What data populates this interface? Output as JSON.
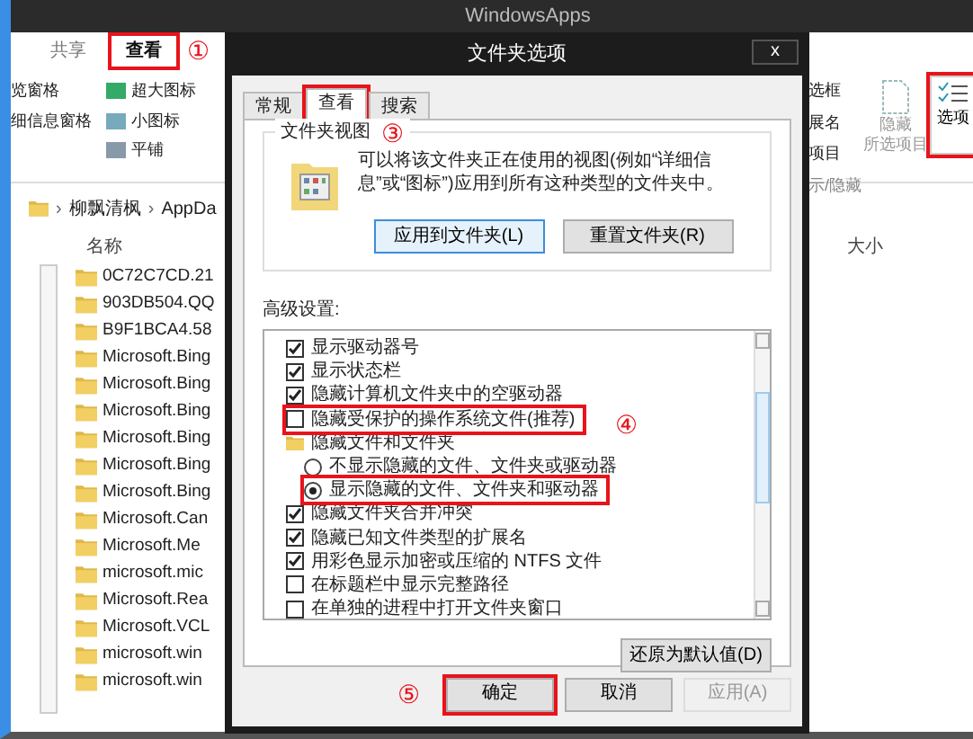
{
  "explorer": {
    "title": "WindowsApps",
    "ribbon_tabs": [
      {
        "label": "共享",
        "selected": false,
        "highlighted": false
      },
      {
        "label": "查看",
        "selected": true,
        "highlighted": true
      }
    ],
    "tab_marker": "①",
    "pane_items": [
      "览窗格",
      "细信息窗格"
    ],
    "layout_items": [
      "超大图标",
      "小图标",
      "平铺"
    ],
    "show_hide_items": [
      "选框",
      "展名",
      "项目"
    ],
    "hide_selected": [
      "隐藏",
      "所选项目"
    ],
    "group_label": "示/隐藏",
    "options_button": {
      "label": "选项",
      "highlighted": true
    },
    "breadcrumb": [
      {
        "separator": "›",
        "label": "柳飘清枫"
      },
      {
        "separator": "›",
        "label": "AppDa"
      }
    ],
    "columns": [
      "名称",
      "大小"
    ],
    "files": [
      "0C72C7CD.21",
      "903DB504.QQ",
      "B9F1BCA4.58",
      "Microsoft.Bing",
      "Microsoft.Bing",
      "Microsoft.Bing",
      "Microsoft.Bing",
      "Microsoft.Bing",
      "Microsoft.Bing",
      "Microsoft.Can",
      "Microsoft.Me",
      "microsoft.mic",
      "Microsoft.Rea",
      "Microsoft.VCL",
      "microsoft.win",
      "microsoft.win"
    ]
  },
  "dialog": {
    "title": "文件夹选项",
    "close": "x",
    "tabs": [
      {
        "label": "常规",
        "selected": false,
        "highlighted": false
      },
      {
        "label": "查看",
        "selected": true,
        "highlighted": true
      },
      {
        "label": "搜索",
        "selected": false,
        "highlighted": false
      }
    ],
    "tab_marker": "③",
    "group_title": "文件夹视图",
    "description": "可以将该文件夹正在使用的视图(例如“详细信息”或“图标”)应用到所有这种类型的文件夹中。",
    "view_buttons": [
      "应用到文件夹(L)",
      "重置文件夹(R)"
    ],
    "advanced_label": "高级设置:",
    "settings": [
      {
        "kind": "checkbox",
        "label": "显示驱动器号",
        "checked": true,
        "highlighted": false
      },
      {
        "kind": "checkbox",
        "label": "显示状态栏",
        "checked": true,
        "highlighted": false
      },
      {
        "kind": "checkbox",
        "label": "隐藏计算机文件夹中的空驱动器",
        "checked": true,
        "highlighted": false
      },
      {
        "kind": "checkbox",
        "label": "隐藏受保护的操作系统文件(推荐)",
        "checked": false,
        "highlighted": true
      },
      {
        "kind": "folder",
        "label": "隐藏文件和文件夹",
        "children": [
          {
            "kind": "radio",
            "label": "不显示隐藏的文件、文件夹或驱动器",
            "checked": false,
            "highlighted": false
          },
          {
            "kind": "radio",
            "label": "显示隐藏的文件、文件夹和驱动器",
            "checked": true,
            "highlighted": true
          }
        ]
      },
      {
        "kind": "checkbox",
        "label": "隐藏文件夹合并冲突",
        "checked": true,
        "highlighted": false
      },
      {
        "kind": "checkbox",
        "label": "隐藏已知文件类型的扩展名",
        "checked": true,
        "highlighted": false
      },
      {
        "kind": "checkbox",
        "label": "用彩色显示加密或压缩的 NTFS 文件",
        "checked": true,
        "highlighted": false
      },
      {
        "kind": "checkbox",
        "label": "在标题栏中显示完整路径",
        "checked": false,
        "highlighted": false
      },
      {
        "kind": "checkbox",
        "label": "在单独的进程中打开文件夹窗口",
        "checked": false,
        "highlighted": false
      }
    ],
    "settings_marker": "④",
    "restore_button": "还原为默认值(D)",
    "footer_marker": "⑤",
    "footer_buttons": [
      {
        "label": "确定",
        "highlighted": true,
        "disabled": false
      },
      {
        "label": "取消",
        "highlighted": false,
        "disabled": false
      },
      {
        "label": "应用(A)",
        "highlighted": false,
        "disabled": true
      }
    ]
  }
}
